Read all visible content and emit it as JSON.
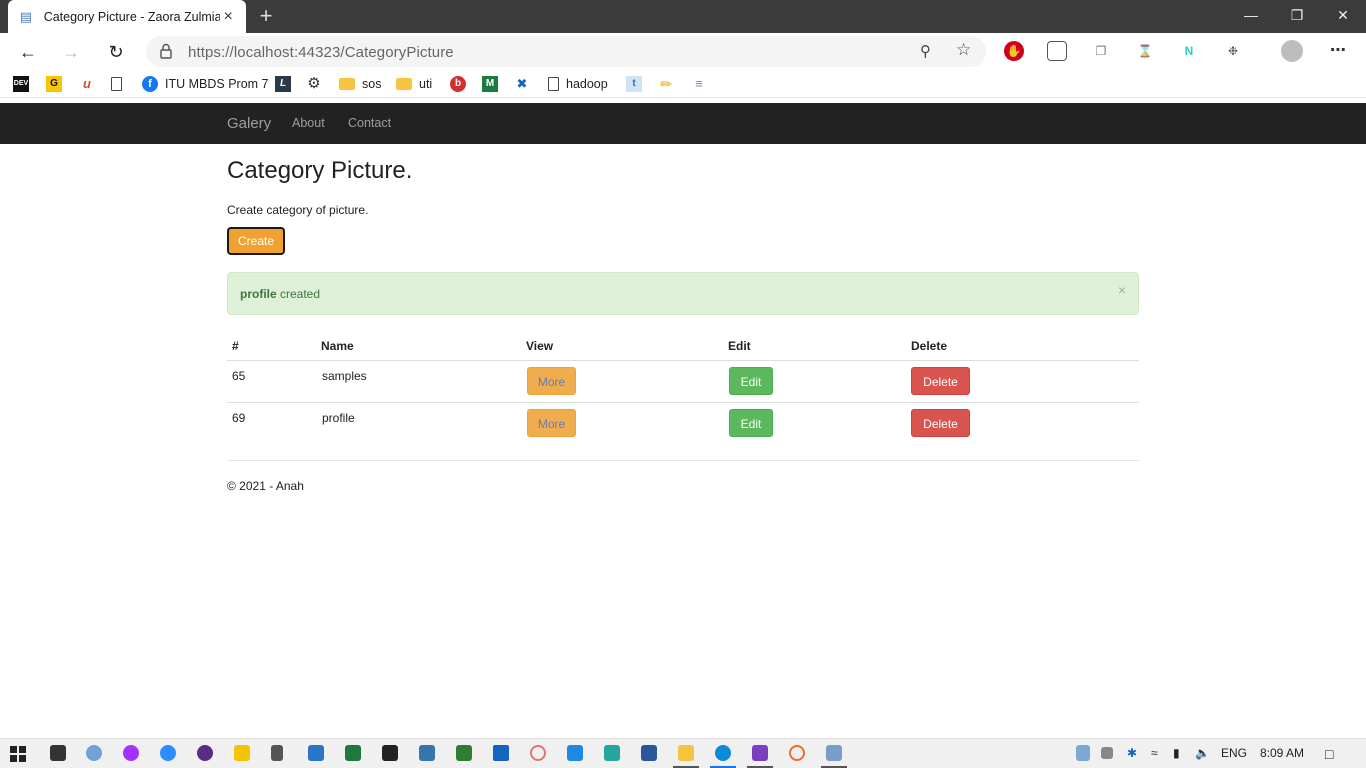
{
  "browser": {
    "tab_title": "Category Picture - Zaora Zulmiar",
    "tab_close": "×",
    "new_tab": "+",
    "url_prefix": "https://localhost",
    "url_port": ":44323",
    "url_path": "/CategoryPicture",
    "window_controls": {
      "minimize": "—",
      "restore": "❐",
      "close": "✕"
    }
  },
  "bookmarks": [
    {
      "label": "",
      "icon": "dev-icon",
      "glyph": "DEV"
    },
    {
      "label": "",
      "icon": "g-icon",
      "glyph": "G"
    },
    {
      "label": "",
      "icon": "u-icon",
      "glyph": "u"
    },
    {
      "label": "",
      "icon": "page-icon",
      "glyph": ""
    },
    {
      "label": "ITU MBDS Prom 7",
      "icon": "facebook-icon",
      "glyph": "f"
    },
    {
      "label": "",
      "icon": "l-icon",
      "glyph": "L"
    },
    {
      "label": "",
      "icon": "settings-icon",
      "glyph": "⚙"
    },
    {
      "label": "sos",
      "icon": "folder-icon",
      "glyph": ""
    },
    {
      "label": "uti",
      "icon": "folder-icon",
      "glyph": ""
    },
    {
      "label": "",
      "icon": "b-icon",
      "glyph": "b"
    },
    {
      "label": "",
      "icon": "m-icon",
      "glyph": "M"
    },
    {
      "label": "",
      "icon": "x-icon",
      "glyph": "✖"
    },
    {
      "label": "hadoop",
      "icon": "page-icon",
      "glyph": ""
    },
    {
      "label": "",
      "icon": "t-icon",
      "glyph": "t"
    },
    {
      "label": "",
      "icon": "pencil-icon",
      "glyph": "✏"
    },
    {
      "label": "",
      "icon": "doc-icon",
      "glyph": "≡"
    }
  ],
  "site": {
    "brand": "Galery",
    "nav": [
      "About",
      "Contact"
    ],
    "page_title": "Category Picture.",
    "subtitle": "Create category of picture.",
    "create_label": "Create",
    "alert": {
      "name": "profile",
      "text": " created",
      "close": "×"
    },
    "table": {
      "headers": [
        "#",
        "Name",
        "View",
        "Edit",
        "Delete"
      ],
      "rows": [
        {
          "id": "65",
          "name": "samples",
          "view": "More",
          "edit": "Edit",
          "delete": "Delete"
        },
        {
          "id": "69",
          "name": "profile",
          "view": "More",
          "edit": "Edit",
          "delete": "Delete"
        }
      ]
    },
    "footer": "© 2021 - Anah"
  },
  "taskbar": {
    "language": "ENG",
    "time": "8:09 AM"
  },
  "colors": {
    "navbar": "#222222",
    "create": "#f0a12f",
    "more": "#f0ad4e",
    "edit": "#5cb85c",
    "delete": "#d9534f",
    "alert_bg": "#dff0d8",
    "alert_text": "#3c763d"
  }
}
